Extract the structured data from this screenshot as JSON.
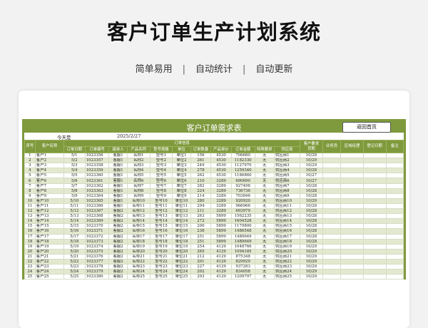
{
  "banner": {
    "title": "客户订单生产计划系统",
    "features": [
      "简单易用",
      "自动统计",
      "自动更新"
    ],
    "separator": "|"
  },
  "sheet": {
    "title": "客户订单需求表",
    "back_button": "返回首页",
    "today_label": "今天是",
    "today_value": "2025/2/27",
    "group_header": "订单信息",
    "columns": [
      "序号",
      "客户名称",
      "订单日期",
      "订单编号",
      "接单人",
      "产品名称",
      "型号规格",
      "单位",
      "订单数量",
      "产品单价",
      "订单金额",
      "特殊要求",
      "供应商",
      "客户要求\n货期",
      "业务员",
      "区域经理",
      "登记日期",
      "备注"
    ],
    "rows": [
      [
        "1",
        "客户1",
        "5/1",
        "1023356",
        "客服1",
        "名称1",
        "型号1",
        "单位1",
        "156",
        "4530",
        "706680",
        "无",
        "供应商1",
        "10/28"
      ],
      [
        "2",
        "客户2",
        "5/2",
        "1023357",
        "客服1",
        "名称2",
        "型号2",
        "单位2",
        "261",
        "4530",
        "1182330",
        "无",
        "供应商2",
        "10/29"
      ],
      [
        "3",
        "客户3",
        "5/3",
        "1023358",
        "客服1",
        "名称3",
        "型号3",
        "单位3",
        "249",
        "4530",
        "1127970",
        "无",
        "供应商3",
        "10/29"
      ],
      [
        "4",
        "客户4",
        "5/4",
        "1023359",
        "客服1",
        "名称4",
        "型号4",
        "单位4",
        "278",
        "4530",
        "1259340",
        "无",
        "供应商4",
        "10/28"
      ],
      [
        "5",
        "客户5",
        "5/5",
        "1023360",
        "客服1",
        "名称5",
        "型号5",
        "单位5",
        "262",
        "4530",
        "1186860",
        "无",
        "供应商5",
        "10/27"
      ],
      [
        "6",
        "客户6",
        "5/6",
        "1023361",
        "客服1",
        "名称6",
        "型号6",
        "单位6",
        "210",
        "3289",
        "690690",
        "无",
        "供应商6",
        "10/27"
      ],
      [
        "7",
        "客户7",
        "5/7",
        "1023362",
        "客服1",
        "名称7",
        "型号7",
        "单位7",
        "282",
        "3289",
        "927498",
        "无",
        "供应商7",
        "10/28"
      ],
      [
        "8",
        "客户8",
        "5/8",
        "1023363",
        "客服1",
        "名称8",
        "型号8",
        "单位8",
        "224",
        "3289",
        "736736",
        "无",
        "供应商8",
        "10/28"
      ],
      [
        "9",
        "客户9",
        "5/9",
        "1023364",
        "客服1",
        "名称9",
        "型号9",
        "单位9",
        "214",
        "3289",
        "703846",
        "无",
        "供应商9",
        "10/28"
      ],
      [
        "10",
        "客户10",
        "5/10",
        "1023365",
        "客服1",
        "名称10",
        "型号10",
        "单位10",
        "280",
        "3289",
        "920920",
        "无",
        "供应商10",
        "10/29"
      ],
      [
        "11",
        "客户11",
        "5/11",
        "1023366",
        "客服1",
        "名称11",
        "型号11",
        "单位11",
        "294",
        "3289",
        "966966",
        "无",
        "供应商11",
        "10/28"
      ],
      [
        "12",
        "客户12",
        "5/12",
        "1023367",
        "客服2",
        "名称12",
        "型号12",
        "单位12",
        "211",
        "3289",
        "693979",
        "无",
        "供应商12",
        "10/28"
      ],
      [
        "13",
        "客户13",
        "5/13",
        "1023368",
        "客服2",
        "名称13",
        "型号13",
        "单位13",
        "263",
        "5899",
        "1562235",
        "无",
        "供应商13",
        "10/28"
      ],
      [
        "14",
        "客户14",
        "5/14",
        "1023369",
        "客服2",
        "名称14",
        "型号14",
        "单位14",
        "272",
        "5899",
        "1604528",
        "无",
        "供应商14",
        "10/28"
      ],
      [
        "15",
        "客户15",
        "5/15",
        "1023370",
        "客服2",
        "名称15",
        "型号15",
        "单位15",
        "200",
        "5899",
        "1179800",
        "无",
        "供应商15",
        "10/28"
      ],
      [
        "16",
        "客户16",
        "5/16",
        "1023371",
        "客服2",
        "名称16",
        "型号16",
        "单位16",
        "236",
        "5899",
        "1486548",
        "无",
        "供应商16",
        "10/28"
      ],
      [
        "17",
        "客户17",
        "5/17",
        "1023372",
        "客服2",
        "名称17",
        "型号17",
        "单位17",
        "251",
        "5899",
        "1480649",
        "无",
        "供应商17",
        "10/28"
      ],
      [
        "18",
        "客户18",
        "5/18",
        "1023373",
        "客服2",
        "名称18",
        "型号18",
        "单位18",
        "251",
        "5899",
        "1480649",
        "无",
        "供应商18",
        "10/28"
      ],
      [
        "19",
        "客户19",
        "5/19",
        "1023374",
        "客服2",
        "名称19",
        "型号19",
        "单位19",
        "254",
        "4129",
        "1048766",
        "无",
        "供应商19",
        "10/29"
      ],
      [
        "20",
        "客户20",
        "5/20",
        "1023375",
        "客服2",
        "名称20",
        "型号20",
        "单位20",
        "265",
        "4129",
        "1094185",
        "无",
        "供应商20",
        "10/29"
      ],
      [
        "21",
        "客户21",
        "5/21",
        "1023376",
        "客服2",
        "名称21",
        "型号21",
        "单位21",
        "212",
        "4129",
        "875348",
        "无",
        "供应商21",
        "10/29"
      ],
      [
        "22",
        "客户22",
        "5/22",
        "1023377",
        "客服2",
        "名称22",
        "型号22",
        "单位22",
        "201",
        "4129",
        "829929",
        "无",
        "供应商22",
        "10/29"
      ],
      [
        "23",
        "客户23",
        "5/23",
        "1023378",
        "客服2",
        "名称23",
        "型号23",
        "单位23",
        "227",
        "4129",
        "937283",
        "无",
        "供应商23",
        "10/29"
      ],
      [
        "24",
        "客户24",
        "5/24",
        "1023379",
        "客服2",
        "名称24",
        "型号24",
        "单位24",
        "202",
        "4129",
        "834058",
        "无",
        "供应商24",
        "10/29"
      ],
      [
        "25",
        "客户25",
        "5/25",
        "1023380",
        "客服2",
        "名称25",
        "型号25",
        "单位25",
        "293",
        "4129",
        "1209797",
        "无",
        "供应商25",
        "10/29"
      ]
    ]
  },
  "colors": {
    "accent": "#7f9a3d",
    "row_alt": "#e3e9cf"
  }
}
